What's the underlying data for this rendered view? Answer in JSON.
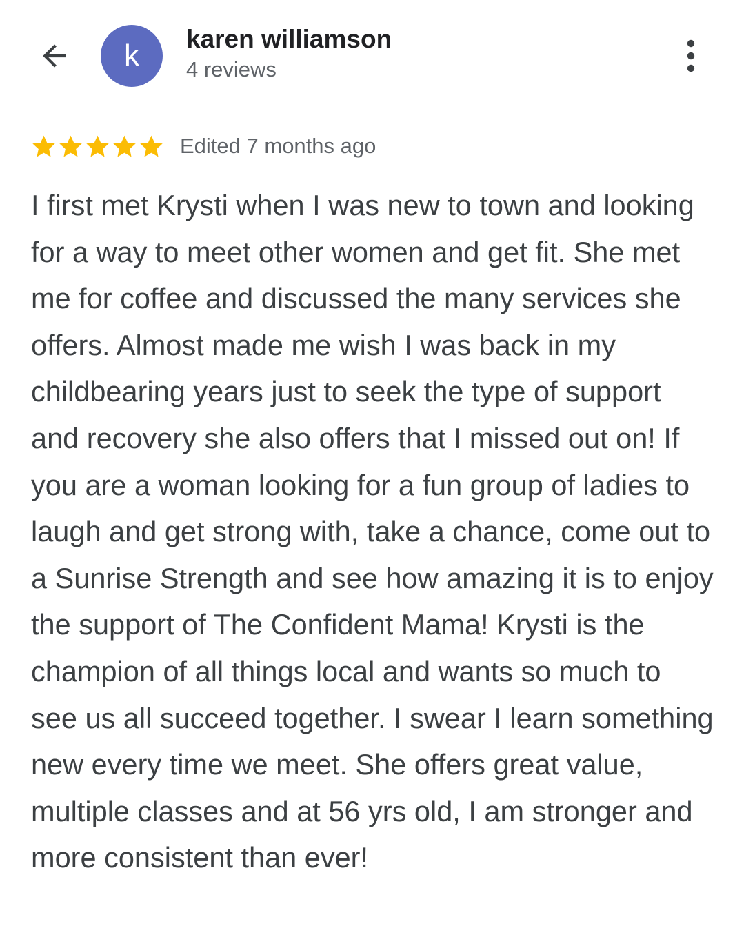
{
  "header": {
    "back_icon": "arrow-left-icon",
    "avatar_initial": "k",
    "avatar_color": "#5c6bc0",
    "user_name": "karen williamson",
    "review_count": "4 reviews",
    "more_icon": "more-vert-icon"
  },
  "review": {
    "rating": 5,
    "rating_max": 5,
    "star_color": "#fbbc04",
    "edited_label": "Edited 7 months ago",
    "text": "I first met Krysti when I was new to town and looking for a way to meet other women and get fit. She met me for coffee and discussed the many services she offers. Almost made me wish I was back in my childbearing years just to seek the type of support and recovery she also offers that I missed out on! If you are a woman looking for a fun group of ladies to laugh and get strong with, take a chance, come out to a Sunrise Strength and see how amazing it is to enjoy the support of The Confident Mama! Krysti is the champion of all things local and wants so much to see us all succeed together. I swear I learn something new every time we meet. She offers great value, multiple classes and at 56 yrs old, I am stronger and more consistent than ever!"
  }
}
